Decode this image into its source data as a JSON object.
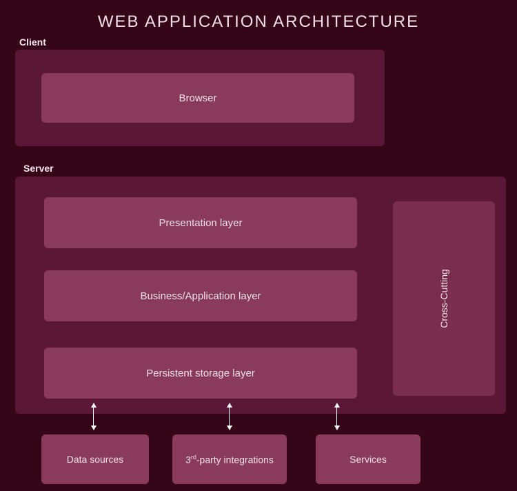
{
  "title": "WEB APPLICATION ARCHITECTURE",
  "client": {
    "label": "Client",
    "browser": "Browser"
  },
  "server": {
    "label": "Server",
    "layers": {
      "presentation": "Presentation layer",
      "business": "Business/Application layer",
      "storage": "Persistent storage layer"
    },
    "crosscutting": "Cross-Cutting"
  },
  "external": {
    "datasources": "Data sources",
    "thirdparty_prefix": "3",
    "thirdparty_sup": "rd",
    "thirdparty_suffix": "-party integrations",
    "services": "Services"
  }
}
